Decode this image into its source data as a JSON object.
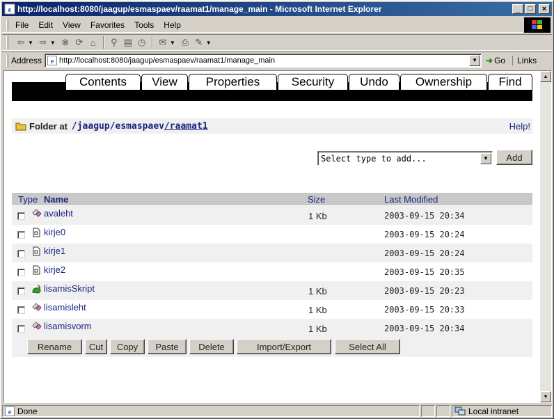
{
  "window": {
    "title": "http://localhost:8080/jaagup/esmaspaev/raamat1/manage_main - Microsoft Internet Explorer",
    "min_label": "_",
    "max_label": "□",
    "close_label": "×"
  },
  "menubar": {
    "items": [
      {
        "label": "File"
      },
      {
        "label": "Edit"
      },
      {
        "label": "View"
      },
      {
        "label": "Favorites"
      },
      {
        "label": "Tools"
      },
      {
        "label": "Help"
      }
    ]
  },
  "toolbar": {
    "icons": [
      "back-icon",
      "forward-icon",
      "stop-icon",
      "refresh-icon",
      "home-icon",
      "search-icon",
      "favorites-icon",
      "history-icon",
      "mail-icon",
      "print-icon",
      "edit-icon"
    ]
  },
  "address": {
    "label": "Address",
    "url": "http://localhost:8080/jaagup/esmaspaev/raamat1/manage_main",
    "go_label": "Go",
    "links_label": "Links"
  },
  "tabs": [
    {
      "label": "Contents",
      "active": true
    },
    {
      "label": "View"
    },
    {
      "label": "Properties"
    },
    {
      "label": "Security"
    },
    {
      "label": "Undo"
    },
    {
      "label": "Ownership"
    },
    {
      "label": "Find"
    }
  ],
  "folder": {
    "prefix": "Folder at",
    "path_parts": [
      "/jaagup",
      "/esmaspaev",
      "/raamat1"
    ],
    "help_label": "Help!"
  },
  "add": {
    "select_value": "Select type to add...",
    "button_label": "Add"
  },
  "table": {
    "headers": {
      "type": "Type",
      "name": "Name",
      "size": "Size",
      "modified": "Last Modified"
    },
    "rows": [
      {
        "name": "avaleht",
        "size": "1 Kb",
        "modified": "2003-09-15 20:34",
        "icon": "dtml-document-icon"
      },
      {
        "name": "kirje0",
        "size": "",
        "modified": "2003-09-15 20:24",
        "icon": "file-icon"
      },
      {
        "name": "kirje1",
        "size": "",
        "modified": "2003-09-15 20:24",
        "icon": "file-icon"
      },
      {
        "name": "kirje2",
        "size": "",
        "modified": "2003-09-15 20:35",
        "icon": "file-icon"
      },
      {
        "name": "lisamisSkript",
        "size": "1 Kb",
        "modified": "2003-09-15 20:23",
        "icon": "python-script-icon"
      },
      {
        "name": "lisamisleht",
        "size": "1 Kb",
        "modified": "2003-09-15 20:33",
        "icon": "dtml-document-icon"
      },
      {
        "name": "lisamisvorm",
        "size": "1 Kb",
        "modified": "2003-09-15 20:34",
        "icon": "dtml-document-icon"
      }
    ]
  },
  "actions": {
    "rename": "Rename",
    "cut": "Cut",
    "copy": "Copy",
    "paste": "Paste",
    "delete": "Delete",
    "import_export": "Import/Export",
    "select_all": "Select All"
  },
  "status": {
    "text": "Done",
    "zone": "Local intranet"
  },
  "colors": {
    "title_bar": "#0a246a",
    "link": "#1a237e",
    "tab_strip": "#000000"
  }
}
